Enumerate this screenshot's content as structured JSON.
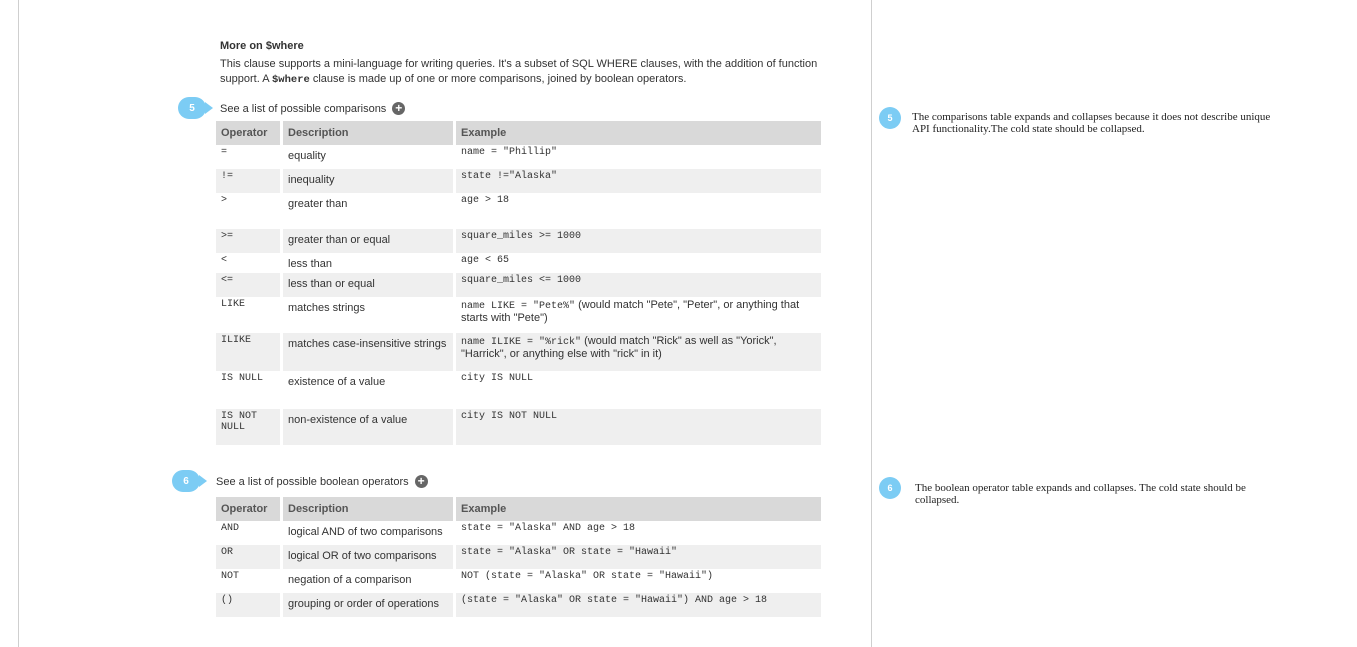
{
  "doc": {
    "title": "More on $where",
    "intro_part1": "This clause supports a mini-language for writing queries. It's a subset of SQL WHERE clauses, with the addition of function support. A ",
    "intro_code": "$where",
    "intro_part2": " clause is made up of one or more comparisons, joined by boolean operators."
  },
  "comparisons": {
    "badge": "5",
    "toggle_label": "See a list of possible comparisons",
    "toggle_icon": "plus-circle-icon",
    "headers": {
      "operator": "Operator",
      "description": "Description",
      "example": "Example"
    },
    "rows": [
      {
        "op": "=",
        "desc": "equality",
        "ex": "name = \"Phillip\"",
        "note": ""
      },
      {
        "op": "!=",
        "desc": "inequality",
        "ex": "state !=\"Alaska\"",
        "note": ""
      },
      {
        "op": ">",
        "desc": "greater than",
        "ex": "age > 18",
        "note": ""
      },
      {
        "op": ">=",
        "desc": "greater than or equal",
        "ex": "square_miles >= 1000",
        "note": ""
      },
      {
        "op": "<",
        "desc": "less than",
        "ex": "age < 65",
        "note": ""
      },
      {
        "op": "<=",
        "desc": "less than or equal",
        "ex": "square_miles <= 1000",
        "note": ""
      },
      {
        "op": "LIKE",
        "desc": "matches strings",
        "ex": "name LIKE = \"Pete%\"",
        "note": " (would match \"Pete\", \"Peter\", or anything that starts with \"Pete\")"
      },
      {
        "op": "ILIKE",
        "desc": "matches case-insensitive strings",
        "ex": "name ILIKE = \"%rick\"",
        "note": " (would match \"Rick\" as well as \"Yorick\", \"Harrick\", or anything else with \"rick\" in it)"
      },
      {
        "op": "IS NULL",
        "desc": "existence of a value",
        "ex": "city IS NULL",
        "note": ""
      },
      {
        "op": "IS NOT NULL",
        "desc": "non-existence of a value",
        "ex": "city IS NOT NULL",
        "note": ""
      }
    ]
  },
  "booleans": {
    "badge": "6",
    "toggle_label": "See a list of possible boolean operators",
    "toggle_icon": "plus-circle-icon",
    "headers": {
      "operator": "Operator",
      "description": "Description",
      "example": "Example"
    },
    "rows": [
      {
        "op": "AND",
        "desc": "logical AND of two comparisons",
        "ex": "state = \"Alaska\" AND age > 18"
      },
      {
        "op": "OR",
        "desc": "logical OR of two comparisons",
        "ex": "state = \"Alaska\" OR state = \"Hawaii\""
      },
      {
        "op": "NOT",
        "desc": "negation of a comparison",
        "ex": "NOT (state = \"Alaska\" OR state = \"Hawaii\")"
      },
      {
        "op": "()",
        "desc": "grouping or order of operations",
        "ex": "(state = \"Alaska\" OR state = \"Hawaii\") AND age > 18"
      }
    ]
  },
  "annotations": [
    {
      "badge": "5",
      "text": "The comparisons table expands and collapses because it does not describe unique API functionality.The cold state should be collapsed."
    },
    {
      "badge": "6",
      "text": "The boolean operator table expands and collapses. The cold state should be collapsed."
    }
  ],
  "colors": {
    "badge": "#7cccf4",
    "header_bg": "#d9d9d9",
    "row_shade": "#efefef",
    "rule": "#cfcfcf"
  }
}
